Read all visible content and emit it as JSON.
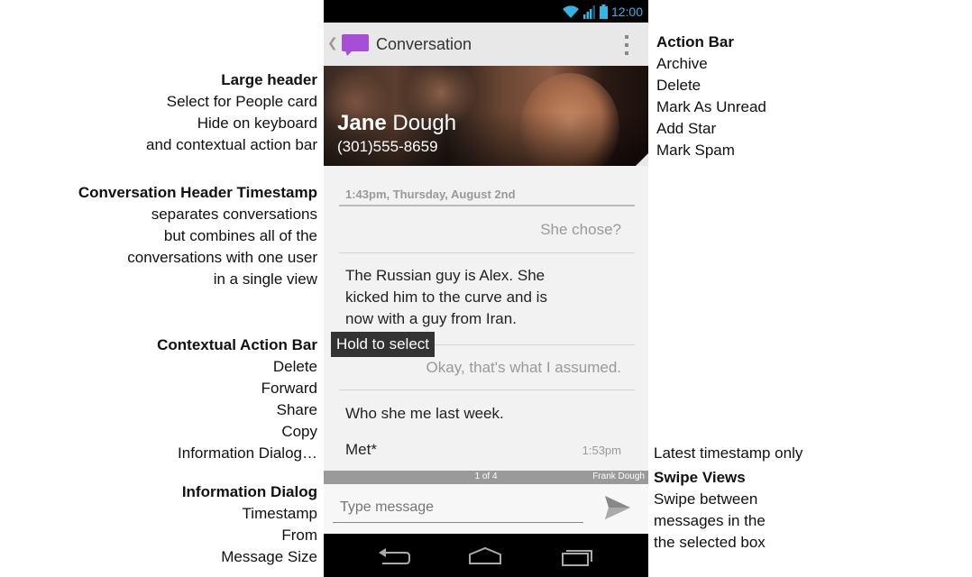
{
  "annotations": {
    "large_header": {
      "title": "Large header",
      "lines": [
        "Select for People card",
        "Hide on keyboard",
        "and contextual action bar"
      ]
    },
    "header_timestamp": {
      "title": "Conversation Header Timestamp",
      "lines": [
        "separates conversations",
        "but combines all of the",
        "conversations with one user",
        "in a single view"
      ]
    },
    "contextual_action_bar": {
      "title": "Contextual Action Bar",
      "lines": [
        "Delete",
        "Forward",
        "Share",
        "Copy",
        "Information Dialog…"
      ]
    },
    "information_dialog": {
      "title": "Information Dialog",
      "lines": [
        "Timestamp",
        "From",
        "Message Size"
      ]
    },
    "action_bar": {
      "title": "Action Bar",
      "lines": [
        "Archive",
        "Delete",
        "Mark As Unread",
        "Add Star",
        "Mark Spam"
      ]
    },
    "latest_timestamp": {
      "text": "Latest timestamp only"
    },
    "swipe_views": {
      "title": "Swipe Views",
      "lines": [
        "Swipe between",
        "messages in the",
        "the selected box"
      ]
    }
  },
  "status_bar": {
    "time": "12:00"
  },
  "action_bar": {
    "title": "Conversation"
  },
  "header": {
    "first_name": "Jane",
    "last_name": "Dough",
    "phone": "(301)555-8659"
  },
  "conversation": {
    "timestamp": "1:43pm, Thursday, August 2nd",
    "messages": [
      {
        "direction": "out",
        "text": "She chose?"
      },
      {
        "direction": "in",
        "lines": [
          "The Russian guy is Alex. She",
          "kicked him to the curve and is",
          "now with a guy from Iran."
        ]
      },
      {
        "direction": "out",
        "text": "Okay, that's what I assumed."
      },
      {
        "direction": "in",
        "text": "Who she me last week."
      },
      {
        "direction": "in",
        "text": "Met*"
      }
    ],
    "tooltip": "Hold to select",
    "latest_time": "1:53pm"
  },
  "swipe_bar": {
    "count": "1 of 4",
    "from": "Frank Dough"
  },
  "compose": {
    "placeholder": "Type message"
  },
  "colors": {
    "accent": "#33b5e5",
    "app_icon": "#a64fd6"
  }
}
